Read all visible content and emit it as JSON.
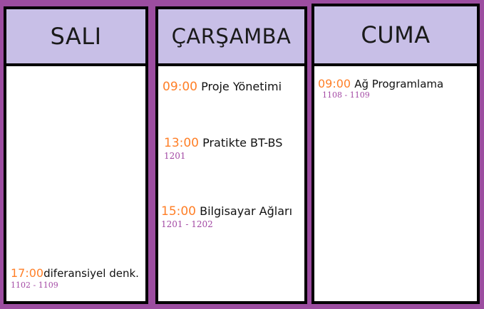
{
  "columns": [
    {
      "day": "SALI",
      "entries": [
        {
          "time": "17:00",
          "course": "diferansiyel denk.",
          "room": "1102 - 1109"
        }
      ]
    },
    {
      "day": "ÇARŞAMBA",
      "entries": [
        {
          "time": "09:00",
          "course": "Proje Yönetimi",
          "room": ""
        },
        {
          "time": "13:00",
          "course": "Pratikte BT-BS",
          "room": "1201"
        },
        {
          "time": "15:00",
          "course": "Bilgisayar Ağları",
          "room": "1201 - 1202"
        }
      ]
    },
    {
      "day": "CUMA",
      "entries": [
        {
          "time": "09:00",
          "course": "Ağ Programlama",
          "room": "1108 - 1109"
        }
      ]
    }
  ],
  "colors": {
    "frame": "#9c4da0",
    "header": "#c8bfe7",
    "border": "#000000",
    "time": "#ff7f27",
    "room": "#a349a4"
  }
}
